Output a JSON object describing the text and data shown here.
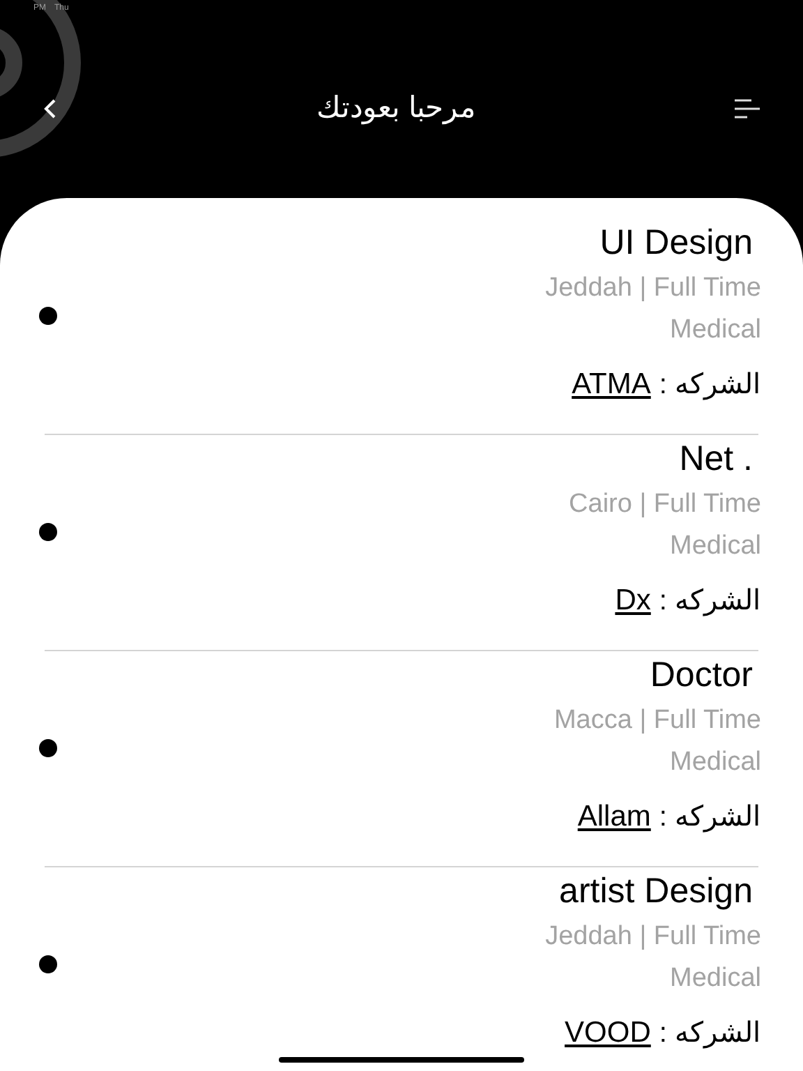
{
  "status_bar": {
    "time": "PM",
    "day": "Thu"
  },
  "header": {
    "title": "مرحبا بعودتك"
  },
  "jobs": [
    {
      "title": "UI Design",
      "location": "Jeddah | Full Time",
      "category": "Medical",
      "company_label": "الشركه :",
      "company": "ATMA"
    },
    {
      "title": "Net .",
      "location": "Cairo | Full Time",
      "category": "Medical",
      "company_label": "الشركه :",
      "company": "Dx"
    },
    {
      "title": "Doctor",
      "location": "Macca | Full Time",
      "category": "Medical",
      "company_label": "الشركه :",
      "company": "Allam"
    },
    {
      "title": "artist Design",
      "location": "Jeddah | Full Time",
      "category": "Medical",
      "company_label": "الشركه :",
      "company": "VOOD"
    }
  ]
}
